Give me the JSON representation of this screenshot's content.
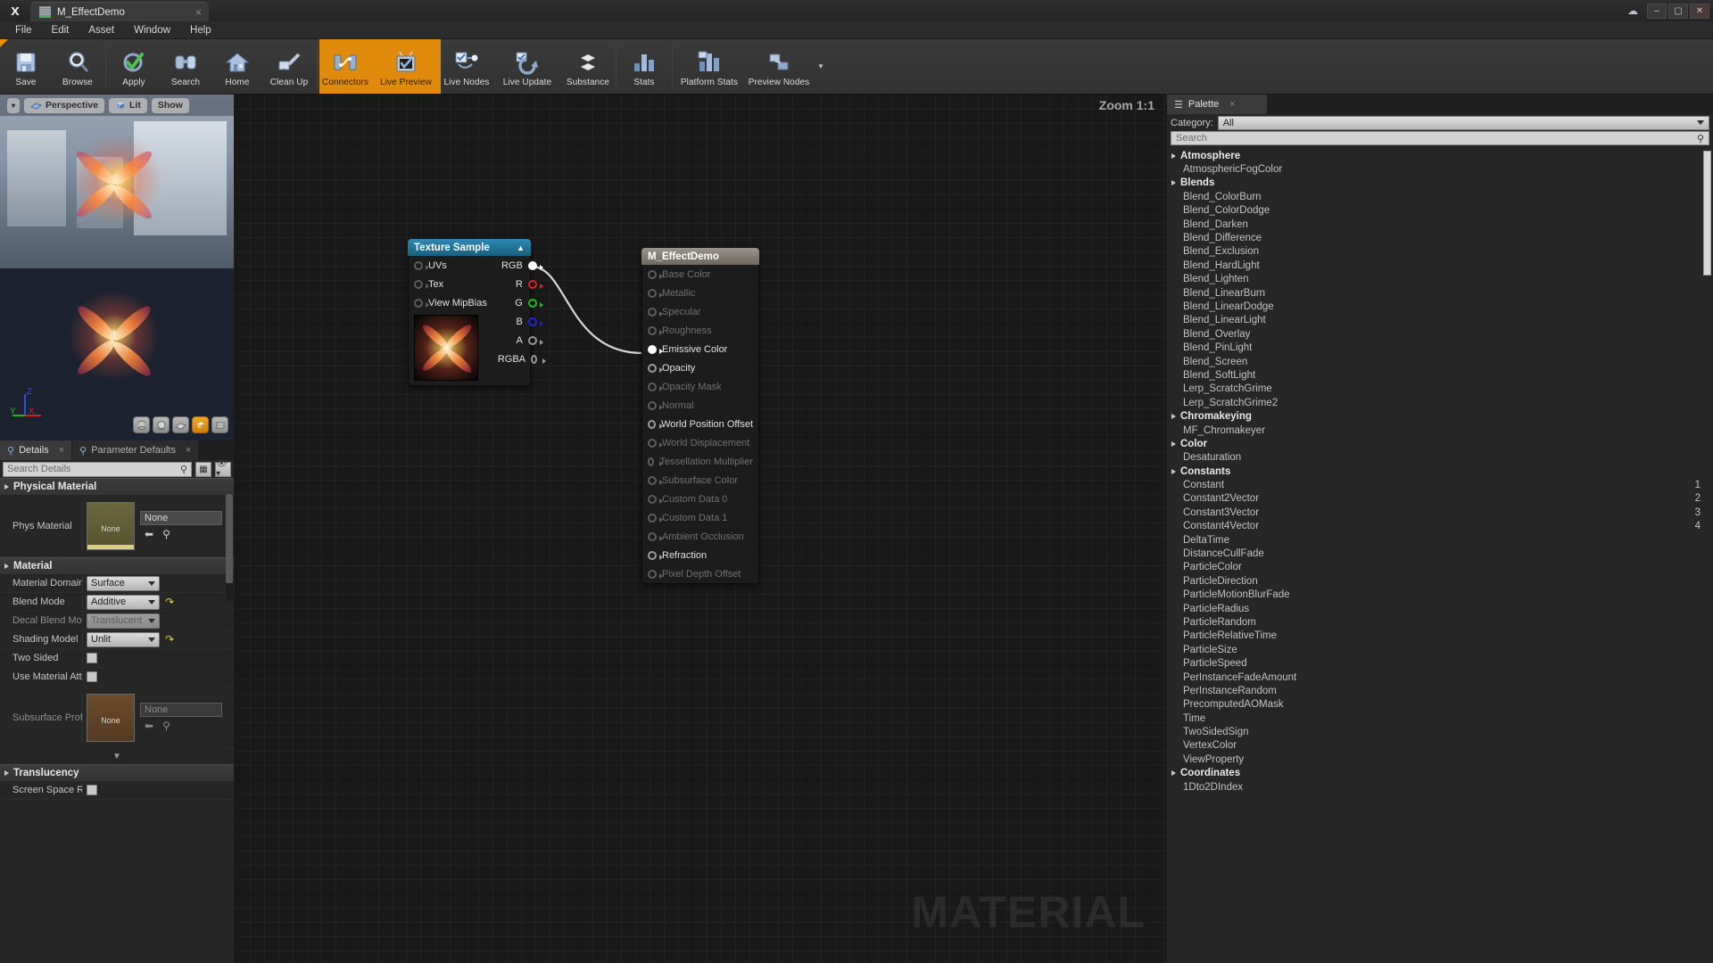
{
  "window": {
    "tab_title": "M_EffectDemo",
    "tab_close": "×",
    "cloud_icon": "cloud-icon",
    "minimize": "–",
    "maximize": "▢",
    "close": "✕"
  },
  "menubar": {
    "items": [
      "File",
      "Edit",
      "Asset",
      "Window",
      "Help"
    ]
  },
  "toolbar": {
    "buttons": [
      {
        "label": "Save",
        "icon": "save-icon",
        "active": false
      },
      {
        "label": "Browse",
        "icon": "browse-icon",
        "active": false
      },
      {
        "label": "Apply",
        "icon": "apply-check-icon",
        "active": false
      },
      {
        "label": "Search",
        "icon": "binoculars-icon",
        "active": false
      },
      {
        "label": "Home",
        "icon": "home-icon",
        "active": false
      },
      {
        "label": "Clean Up",
        "icon": "cleanup-icon",
        "active": false
      },
      {
        "label": "Connectors",
        "icon": "connectors-icon",
        "active": true
      },
      {
        "label": "Live Preview",
        "icon": "live-preview-icon",
        "active": true
      },
      {
        "label": "Live Nodes",
        "icon": "live-nodes-icon",
        "active": false
      },
      {
        "label": "Live Update",
        "icon": "live-update-icon",
        "active": false
      },
      {
        "label": "Substance",
        "icon": "substance-icon",
        "active": false
      },
      {
        "label": "Stats",
        "icon": "stats-icon",
        "active": false
      },
      {
        "label": "Platform Stats",
        "icon": "platform-stats-icon",
        "active": false
      },
      {
        "label": "Preview Nodes",
        "icon": "preview-nodes-icon",
        "active": false
      }
    ],
    "overflow": "▾"
  },
  "viewport": {
    "view_mode_dropdown": "▾",
    "perspective": "Perspective",
    "lit": "Lit",
    "show": "Show",
    "axis": {
      "x": "X",
      "y": "Y",
      "z": "Z"
    },
    "shape_buttons": [
      "cylinder-preview",
      "sphere-preview",
      "plane-preview",
      "cube-preview-selected",
      "custom-mesh-preview"
    ]
  },
  "details": {
    "tabs": [
      {
        "label": "Details",
        "active": true,
        "close": "×"
      },
      {
        "label": "Parameter Defaults",
        "active": false,
        "close": "×"
      }
    ],
    "search_placeholder": "Search Details",
    "sections": [
      {
        "title": "Physical Material",
        "rows": [
          {
            "label": "Phys Material",
            "type": "asset",
            "thumb_text": "None",
            "value": "None",
            "thumb_style": "olive",
            "disabled": false
          }
        ]
      },
      {
        "title": "Material",
        "rows": [
          {
            "label": "Material Domain",
            "type": "combo",
            "value": "Surface",
            "disabled": false,
            "reset": false
          },
          {
            "label": "Blend Mode",
            "type": "combo",
            "value": "Additive",
            "disabled": false,
            "reset": true
          },
          {
            "label": "Decal Blend Mode",
            "type": "combo",
            "value": "Translucent",
            "disabled": true,
            "reset": false
          },
          {
            "label": "Shading Model",
            "type": "combo",
            "value": "Unlit",
            "disabled": false,
            "reset": true
          },
          {
            "label": "Two Sided",
            "type": "checkbox",
            "value": "",
            "disabled": false,
            "reset": false
          },
          {
            "label": "Use Material Attributes",
            "type": "checkbox",
            "value": "",
            "disabled": false,
            "reset": false
          },
          {
            "label": "Subsurface Profile",
            "type": "asset",
            "thumb_text": "None",
            "value": "None",
            "thumb_style": "brown",
            "disabled": true
          }
        ]
      },
      {
        "title": "Translucency",
        "rows": [
          {
            "label": "Screen Space Reflections",
            "type": "checkbox",
            "value": "",
            "disabled": false,
            "reset": false
          }
        ]
      }
    ]
  },
  "graph": {
    "zoom_label": "Zoom 1:1",
    "watermark": "MATERIAL",
    "nodes": [
      {
        "id": "texture-sample",
        "title": "Texture Sample",
        "collapse_icon": "▲",
        "inputs": [
          {
            "label": "UVs",
            "connected": false
          },
          {
            "label": "Tex",
            "connected": false
          },
          {
            "label": "View MipBias",
            "connected": false
          }
        ],
        "outputs": [
          {
            "label": "RGB",
            "color": "white",
            "connected": true
          },
          {
            "label": "R",
            "color": "red",
            "connected": false
          },
          {
            "label": "G",
            "color": "green",
            "connected": false
          },
          {
            "label": "B",
            "color": "blue",
            "connected": false
          },
          {
            "label": "A",
            "color": "gray",
            "connected": false
          },
          {
            "label": "RGBA",
            "color": "gray",
            "connected": false
          }
        ]
      },
      {
        "id": "material-output",
        "title": "M_EffectDemo",
        "inputs": [
          {
            "label": "Base Color",
            "enabled": false
          },
          {
            "label": "Metallic",
            "enabled": false
          },
          {
            "label": "Specular",
            "enabled": false
          },
          {
            "label": "Roughness",
            "enabled": false
          },
          {
            "label": "Emissive Color",
            "enabled": true,
            "connected": true
          },
          {
            "label": "Opacity",
            "enabled": true
          },
          {
            "label": "Opacity Mask",
            "enabled": false
          },
          {
            "label": "Normal",
            "enabled": false
          },
          {
            "label": "World Position Offset",
            "enabled": true
          },
          {
            "label": "World Displacement",
            "enabled": false
          },
          {
            "label": "Tessellation Multiplier",
            "enabled": false
          },
          {
            "label": "Subsurface Color",
            "enabled": false
          },
          {
            "label": "Custom Data 0",
            "enabled": false
          },
          {
            "label": "Custom Data 1",
            "enabled": false
          },
          {
            "label": "Ambient Occlusion",
            "enabled": false
          },
          {
            "label": "Refraction",
            "enabled": true
          },
          {
            "label": "Pixel Depth Offset",
            "enabled": false
          }
        ]
      }
    ]
  },
  "palette": {
    "tab_label": "Palette",
    "tab_close": "×",
    "category_label": "Category:",
    "category_value": "All",
    "search_placeholder": "Search",
    "tree": [
      {
        "type": "group",
        "label": "Atmosphere"
      },
      {
        "type": "item",
        "label": "AtmosphericFogColor"
      },
      {
        "type": "group",
        "label": "Blends"
      },
      {
        "type": "item",
        "label": "Blend_ColorBurn"
      },
      {
        "type": "item",
        "label": "Blend_ColorDodge"
      },
      {
        "type": "item",
        "label": "Blend_Darken"
      },
      {
        "type": "item",
        "label": "Blend_Difference"
      },
      {
        "type": "item",
        "label": "Blend_Exclusion"
      },
      {
        "type": "item",
        "label": "Blend_HardLight"
      },
      {
        "type": "item",
        "label": "Blend_Lighten"
      },
      {
        "type": "item",
        "label": "Blend_LinearBurn"
      },
      {
        "type": "item",
        "label": "Blend_LinearDodge"
      },
      {
        "type": "item",
        "label": "Blend_LinearLight"
      },
      {
        "type": "item",
        "label": "Blend_Overlay"
      },
      {
        "type": "item",
        "label": "Blend_PinLight"
      },
      {
        "type": "item",
        "label": "Blend_Screen"
      },
      {
        "type": "item",
        "label": "Blend_SoftLight"
      },
      {
        "type": "item",
        "label": "Lerp_ScratchGrime"
      },
      {
        "type": "item",
        "label": "Lerp_ScratchGrime2"
      },
      {
        "type": "group",
        "label": "Chromakeying"
      },
      {
        "type": "item",
        "label": "MF_Chromakeyer"
      },
      {
        "type": "group",
        "label": "Color"
      },
      {
        "type": "item",
        "label": "Desaturation"
      },
      {
        "type": "group",
        "label": "Constants"
      },
      {
        "type": "item",
        "label": "Constant",
        "count": "1"
      },
      {
        "type": "item",
        "label": "Constant2Vector",
        "count": "2"
      },
      {
        "type": "item",
        "label": "Constant3Vector",
        "count": "3"
      },
      {
        "type": "item",
        "label": "Constant4Vector",
        "count": "4"
      },
      {
        "type": "item",
        "label": "DeltaTime"
      },
      {
        "type": "item",
        "label": "DistanceCullFade"
      },
      {
        "type": "item",
        "label": "ParticleColor"
      },
      {
        "type": "item",
        "label": "ParticleDirection"
      },
      {
        "type": "item",
        "label": "ParticleMotionBlurFade"
      },
      {
        "type": "item",
        "label": "ParticleRadius"
      },
      {
        "type": "item",
        "label": "ParticleRandom"
      },
      {
        "type": "item",
        "label": "ParticleRelativeTime"
      },
      {
        "type": "item",
        "label": "ParticleSize"
      },
      {
        "type": "item",
        "label": "ParticleSpeed"
      },
      {
        "type": "item",
        "label": "PerInstanceFadeAmount"
      },
      {
        "type": "item",
        "label": "PerInstanceRandom"
      },
      {
        "type": "item",
        "label": "PrecomputedAOMask"
      },
      {
        "type": "item",
        "label": "Time"
      },
      {
        "type": "item",
        "label": "TwoSidedSign"
      },
      {
        "type": "item",
        "label": "VertexColor"
      },
      {
        "type": "item",
        "label": "ViewProperty"
      },
      {
        "type": "group",
        "label": "Coordinates"
      },
      {
        "type": "item",
        "label": "1Dto2DIndex"
      }
    ]
  },
  "colors": {
    "accent_orange": "#e08a0b",
    "node_header_blue": "#1f6f96",
    "panel_bg": "#262626",
    "graph_bg": "#191919"
  }
}
